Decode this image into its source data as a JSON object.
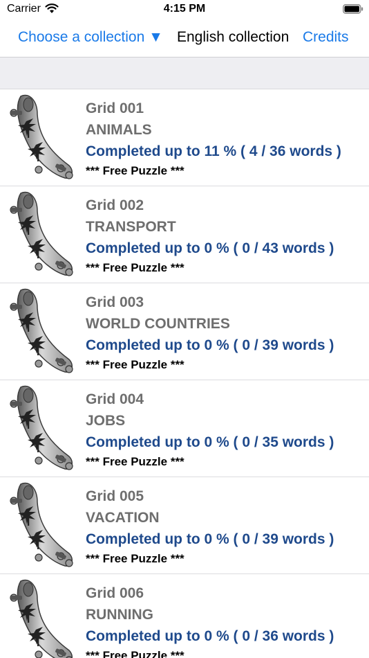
{
  "status_bar": {
    "carrier": "Carrier",
    "time": "4:15 PM"
  },
  "nav": {
    "choose_label": "Choose a collection ▼",
    "title": "English collection",
    "credits_label": "Credits"
  },
  "colors": {
    "link_blue": "#1a7ae8",
    "progress_blue": "#1f4a8c",
    "grey_text": "#6e6e6e",
    "section_bg": "#eeeef2"
  },
  "grids": [
    {
      "name": "Grid 001",
      "category": "ANIMALS",
      "progress": "Completed up to 11 % ( 4 / 36 words )",
      "badge": "*** Free Puzzle ***",
      "icon": "surfboard-palm-icon"
    },
    {
      "name": "Grid 002",
      "category": "TRANSPORT",
      "progress": "Completed up to 0 % ( 0 / 43 words )",
      "badge": "*** Free Puzzle ***",
      "icon": "surfboard-palm-icon"
    },
    {
      "name": "Grid 003",
      "category": "WORLD COUNTRIES",
      "progress": "Completed up to 0 % ( 0 / 39 words )",
      "badge": "*** Free Puzzle ***",
      "icon": "surfboard-palm-icon"
    },
    {
      "name": "Grid 004",
      "category": "JOBS",
      "progress": "Completed up to 0 % ( 0 / 35 words )",
      "badge": "*** Free Puzzle ***",
      "icon": "surfboard-palm-icon"
    },
    {
      "name": "Grid 005",
      "category": "VACATION",
      "progress": "Completed up to 0 % ( 0 / 39 words )",
      "badge": "*** Free Puzzle ***",
      "icon": "surfboard-palm-icon"
    },
    {
      "name": "Grid 006",
      "category": "RUNNING",
      "progress": "Completed up to 0 % ( 0 / 36 words )",
      "badge": "*** Free Puzzle ***",
      "icon": "surfboard-palm-icon"
    }
  ]
}
